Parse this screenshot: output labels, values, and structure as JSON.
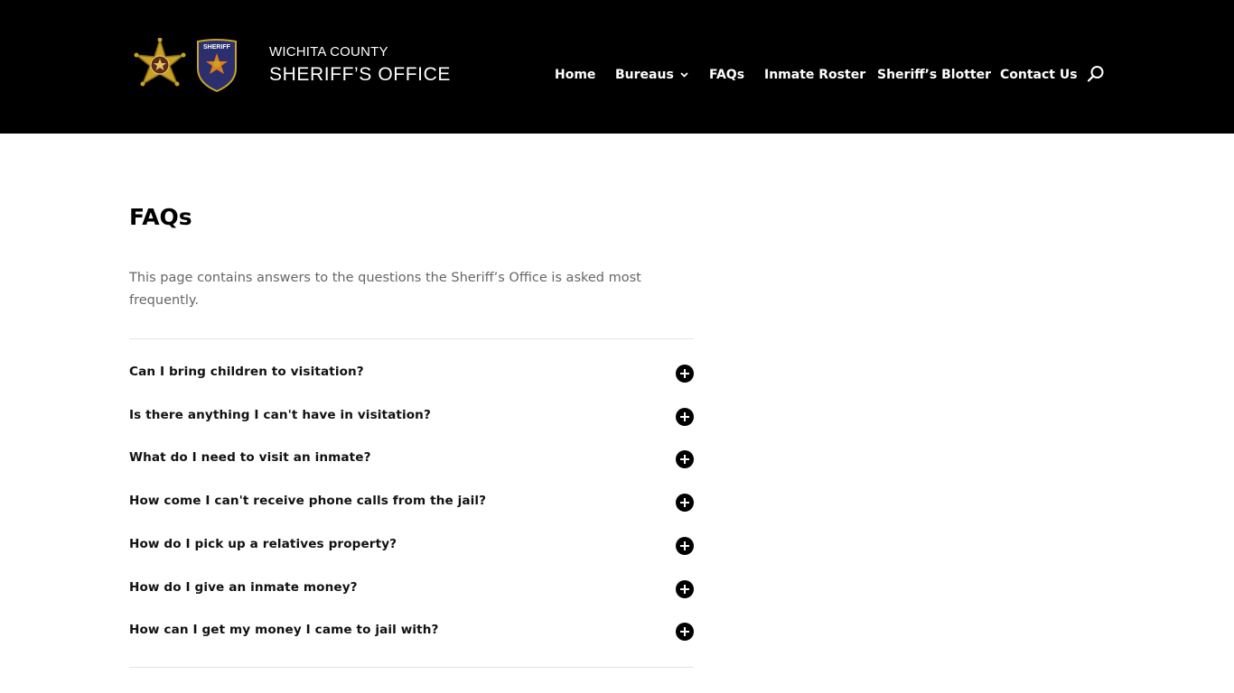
{
  "header": {
    "brand_line1": "WICHITA COUNTY",
    "brand_line2": "SHERIFF’S OFFICE",
    "logos": [
      "sheriff-star-badge",
      "sheriff-shield-patch"
    ],
    "shield_text": "SHERIFF",
    "nav": [
      {
        "label": "Home"
      },
      {
        "label": "Bureaus",
        "has_dropdown": true
      },
      {
        "label": "FAQs"
      },
      {
        "label": "Inmate Roster"
      },
      {
        "label": "Sheriff’s Blotter"
      },
      {
        "label": "Contact Us"
      }
    ],
    "search_icon": "search-icon",
    "background": "#000000"
  },
  "main": {
    "title": "FAQs",
    "intro": "This page contains answers to the questions the Sheriff’s Office is asked most frequently.",
    "faqs": [
      {
        "question": "Can I bring children to visitation?",
        "expanded": false
      },
      {
        "question": "Is there anything I can't have in visitation?",
        "expanded": false
      },
      {
        "question": "What do I need to visit an inmate?",
        "expanded": false
      },
      {
        "question": "How come I can't receive phone calls from the jail?",
        "expanded": false
      },
      {
        "question": "How do I pick up a relatives property?",
        "expanded": false
      },
      {
        "question": "How do I give an inmate money?",
        "expanded": false
      },
      {
        "question": "How can I get my money I came to jail with?",
        "expanded": false
      }
    ],
    "toggle_icon": "plus-circle-icon"
  },
  "colors": {
    "header_bg": "#000000",
    "text_dark": "#111111",
    "text_muted": "#666666",
    "divider": "#e3e3e3",
    "star_gold": "#c9a227",
    "shield_blue": "#2b2f6e"
  }
}
